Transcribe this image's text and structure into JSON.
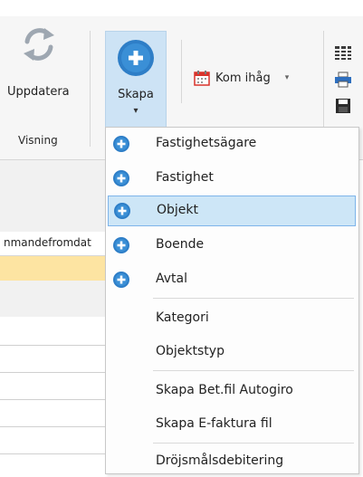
{
  "ribbon": {
    "update_label": "Uppdatera",
    "group_label": "Visning",
    "skapa_label": "Skapa",
    "skapa_arrow": "▾",
    "komihag_label": "Kom ihåg",
    "komihag_caret": "▾"
  },
  "grid": {
    "column_header": "nmandefromdat"
  },
  "menu": {
    "items": [
      {
        "label": "Fastighetsägare",
        "icon": "plus-circle-icon"
      },
      {
        "label": "Fastighet",
        "icon": "plus-circle-icon"
      },
      {
        "label": "Objekt",
        "icon": "plus-circle-icon",
        "selected": true
      },
      {
        "label": "Boende",
        "icon": "plus-circle-icon"
      },
      {
        "label": "Avtal",
        "icon": "plus-circle-icon"
      },
      {
        "label": "Kategori"
      },
      {
        "label": "Objektstyp"
      },
      {
        "label": "Skapa Bet.fil Autogiro"
      },
      {
        "label": "Skapa E-faktura fil"
      },
      {
        "label": "Dröjsmålsdebitering"
      }
    ]
  },
  "colors": {
    "accent_blue": "#2e7ec7",
    "selection_bg": "#cde6f7",
    "selection_border": "#7eb4ea",
    "row_highlight": "#fde4a2",
    "calendar_red": "#d9332b"
  }
}
